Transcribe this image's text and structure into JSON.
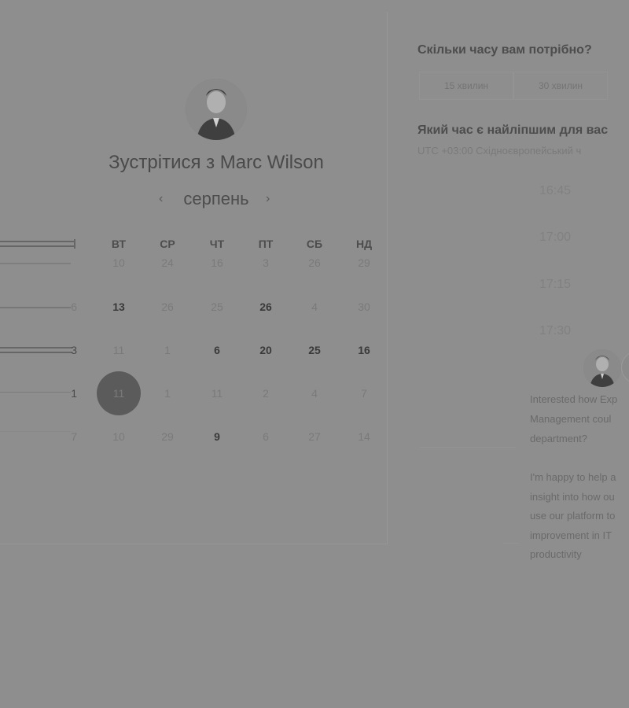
{
  "booking": {
    "title": "Зустрітися з Marc Wilson",
    "month": "серпень",
    "prev_icon": "‹",
    "next_icon": "›"
  },
  "calendar": {
    "weekdays": [
      "ВТ",
      "СР",
      "ЧТ",
      "ПТ",
      "СБ",
      "НД"
    ],
    "rows": [
      {
        "end": "",
        "cells": [
          "10",
          "24",
          "16",
          "3",
          "26",
          "29"
        ]
      },
      {
        "end": "6",
        "cells": [
          "13",
          "26",
          "25",
          "26",
          "4",
          "30"
        ]
      },
      {
        "end": "3",
        "cells": [
          "11",
          "1",
          "6",
          "20",
          "25",
          "16"
        ]
      },
      {
        "end": "1",
        "cells": [
          "11",
          "1",
          "11",
          "2",
          "4",
          "7"
        ]
      },
      {
        "end": "7",
        "cells": [
          "10",
          "29",
          "9",
          "6",
          "27",
          "14"
        ]
      }
    ],
    "selected": "11"
  },
  "duration": {
    "question": "Скільки часу вам потрібно?",
    "options": [
      "15 хвилин",
      "30 хвилин"
    ]
  },
  "time": {
    "question": "Який час є найліпшим для вас",
    "timezone": "UTC +03:00 Східноєвропейський ч",
    "slots": [
      "16:45",
      "17:00",
      "17:15",
      "17:30"
    ]
  },
  "chat": {
    "lines": [
      "Interested how Exp",
      "Management coul",
      "department?",
      "I'm happy to help a",
      "insight into how ou",
      "use our platform to",
      "improvement in IT",
      "productivity"
    ]
  }
}
